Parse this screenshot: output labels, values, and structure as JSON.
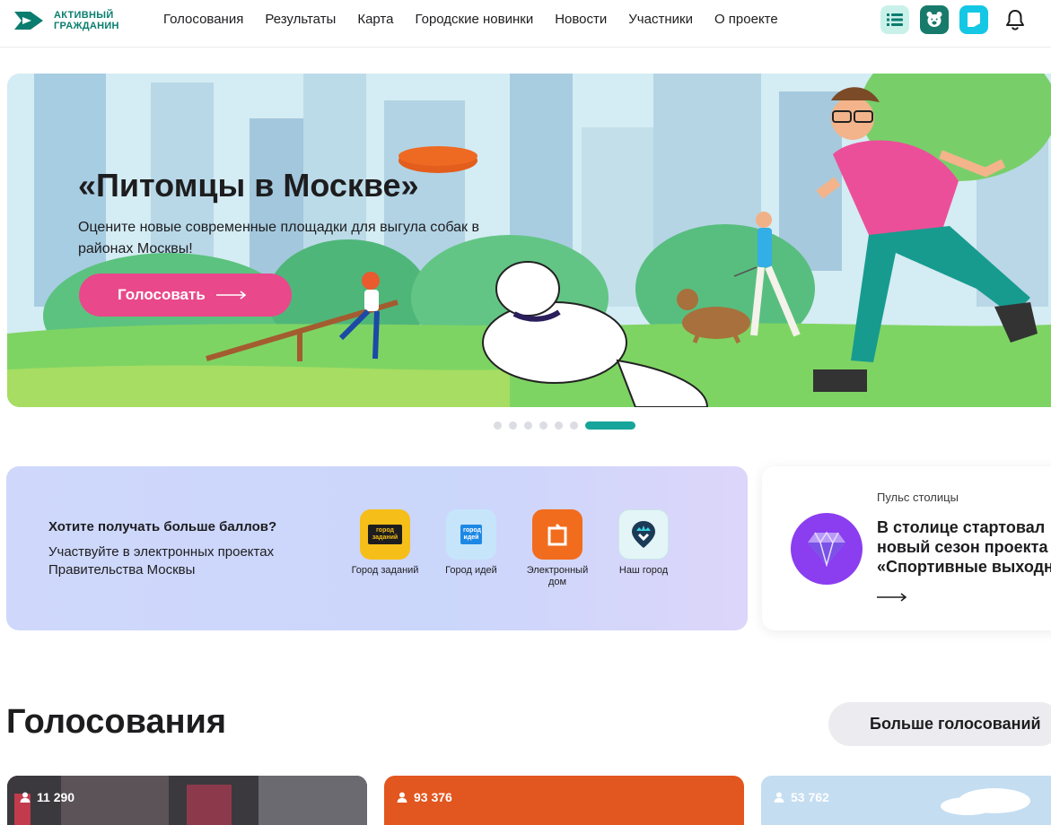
{
  "header": {
    "logo_line1": "АКТИВНЫЙ",
    "logo_line2": "ГРАЖДАНИН",
    "nav": [
      "Голосования",
      "Результаты",
      "Карта",
      "Городские новинки",
      "Новости",
      "Участники",
      "О проекте"
    ],
    "icons": [
      "list-icon",
      "bear-icon",
      "bookmark-icon",
      "bell-icon"
    ]
  },
  "hero": {
    "title": "«Питомцы в Москве»",
    "subtitle": "Оцените новые современные площадки для выгула собак в районах Москвы!",
    "button": "Голосовать",
    "slides_total": 7,
    "active_slide": 7
  },
  "points": {
    "title": "Хотите получать больше баллов?",
    "subtitle": "Участвуйте в электронных проектах Правительства Москвы",
    "apps": [
      {
        "label": "Город заданий",
        "icon_text": "город заданий",
        "color": "#f6be19"
      },
      {
        "label": "Город идей",
        "icon_text": "город идей",
        "color": "#b9dffb"
      },
      {
        "label": "Электронный дом",
        "icon_text": "",
        "color": "#f26c1d"
      },
      {
        "label": "Наш город",
        "icon_text": "",
        "color": "#e3f5f6"
      }
    ]
  },
  "pulse": {
    "eyebrow": "Пульс столицы",
    "line1": "В столице стартовал",
    "line2": "новый сезон проекта",
    "line3": "«Спортивные выходны"
  },
  "votings": {
    "title": "Голосования",
    "more_button": "Больше голосований",
    "cards": [
      {
        "count": "11 290"
      },
      {
        "count": "93 376"
      },
      {
        "count": "53 762"
      }
    ]
  },
  "colors": {
    "accent": "#17a49a",
    "brand": "#0a7d6e",
    "button_pink": "#e9488b"
  }
}
